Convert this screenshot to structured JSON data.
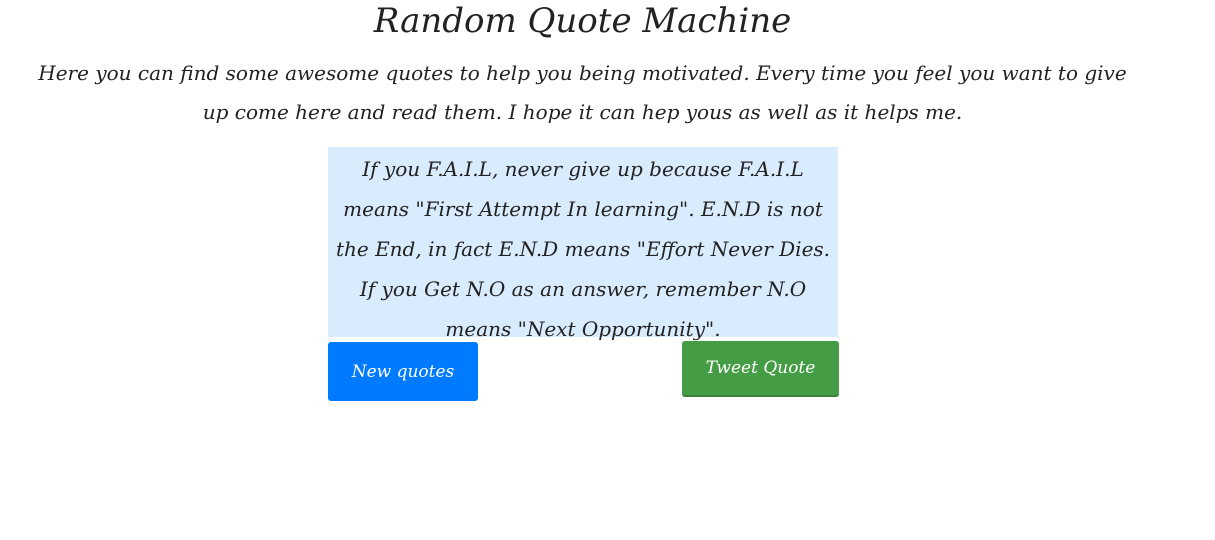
{
  "page": {
    "title": "Random Quote Machine",
    "intro": "Here you can find some awesome quotes to help you being motivated. Every time you feel you want to give up come here and read them. I hope it can hep yous as well as it helps me."
  },
  "quote": {
    "text": "If you F.A.I.L, never give up because F.A.I.L means \"First Attempt In learning\". E.N.D is not the End, in fact E.N.D means \"Effort Never Dies. If you Get N.O as an answer, remember N.O means \"Next Opportunity\"."
  },
  "buttons": {
    "new_quote_label": "New quotes",
    "tweet_label": "Tweet Quote"
  },
  "colors": {
    "quote_background": "#d9ecfd",
    "new_quote_button": "#007bff",
    "tweet_button": "#449d44"
  }
}
